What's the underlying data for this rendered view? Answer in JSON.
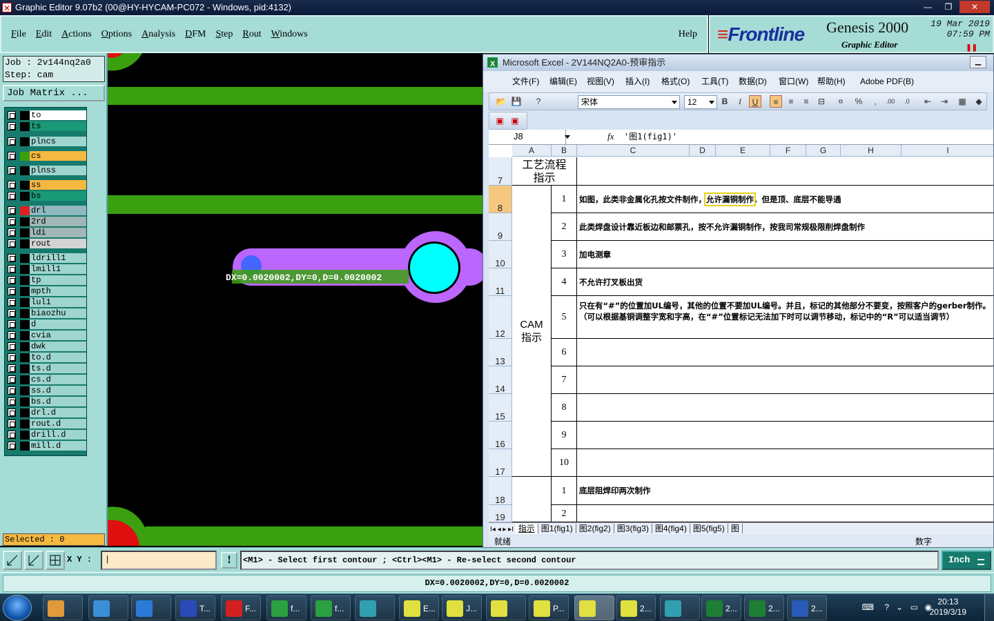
{
  "genesis": {
    "window_title": "Graphic Editor 9.07b2 (00@HY-HYCAM-PC072 - Windows, pid:4132)",
    "menu": [
      "File",
      "Edit",
      "Actions",
      "Options",
      "Analysis",
      "DFM",
      "Step",
      "Rout",
      "Windows"
    ],
    "help": "Help",
    "brand": {
      "logo": "Frontline",
      "product": "Genesis 2000",
      "subtitle": "Graphic Editor",
      "date": "19 Mar 2019",
      "time": "07:59 PM"
    },
    "job": "Job : 2v144nq2a0",
    "step": "Step: cam",
    "job_matrix": "Job Matrix ...",
    "layers": [
      {
        "name": "to",
        "color": "#ffffff",
        "swatch": "#000000"
      },
      {
        "name": "ts",
        "color": "#1a9977",
        "swatch": "#000000"
      },
      {
        "name": "plncs",
        "color": "#9ed5ce",
        "swatch": "#000000"
      },
      {
        "name": "cs",
        "color": "#f5b841",
        "swatch": "#3aa010"
      },
      {
        "name": "plnss",
        "color": "#9ed5ce",
        "swatch": "#000000"
      },
      {
        "name": "ss",
        "color": "#f5b841",
        "swatch": "#000000"
      },
      {
        "name": "bs",
        "color": "#1a9977",
        "swatch": "#000000"
      },
      {
        "name": "drl",
        "color": "#8fb8bf",
        "swatch": "#e02020"
      },
      {
        "name": "2rd",
        "color": "#9fb7b5",
        "swatch": "#000000"
      },
      {
        "name": "ldi",
        "color": "#9fb7b5",
        "swatch": "#000000"
      },
      {
        "name": "rout",
        "color": "#d3d3d3",
        "swatch": "#000000"
      },
      {
        "name": "ldrill1",
        "color": "#9ed5ce",
        "swatch": "#000000"
      },
      {
        "name": "lmill1",
        "color": "#9ed5ce",
        "swatch": "#000000"
      },
      {
        "name": "tp",
        "color": "#9ed5ce",
        "swatch": "#000000"
      },
      {
        "name": "mpth",
        "color": "#9ed5ce",
        "swatch": "#000000"
      },
      {
        "name": "lul1",
        "color": "#9ed5ce",
        "swatch": "#000000"
      },
      {
        "name": "biaozhu",
        "color": "#9ed5ce",
        "swatch": "#000000"
      },
      {
        "name": "d",
        "color": "#9ed5ce",
        "swatch": "#000000"
      },
      {
        "name": "cvia",
        "color": "#9ed5ce",
        "swatch": "#000000"
      },
      {
        "name": "dwk",
        "color": "#9ed5ce",
        "swatch": "#000000"
      },
      {
        "name": "to.d",
        "color": "#9ed5ce",
        "swatch": "#000000"
      },
      {
        "name": "ts.d",
        "color": "#9ed5ce",
        "swatch": "#000000"
      },
      {
        "name": "cs.d",
        "color": "#9ed5ce",
        "swatch": "#000000"
      },
      {
        "name": "ss.d",
        "color": "#9ed5ce",
        "swatch": "#000000"
      },
      {
        "name": "bs.d",
        "color": "#9ed5ce",
        "swatch": "#000000"
      },
      {
        "name": "drl.d",
        "color": "#9ed5ce",
        "swatch": "#000000"
      },
      {
        "name": "rout.d",
        "color": "#9ed5ce",
        "swatch": "#000000"
      },
      {
        "name": "drill.d",
        "color": "#9ed5ce",
        "swatch": "#000000"
      },
      {
        "name": "mill.d",
        "color": "#9ed5ce",
        "swatch": "#000000"
      }
    ],
    "selected": "Selected : 0",
    "measure_label": "DX=0.0020002,DY=0,D=0.0020002",
    "xy_label": "X Y :",
    "prompt": "<M1> - Select first contour ; <Ctrl><M1> - Re-select second contour",
    "units": "Inch",
    "status": "DX=0.0020002,DY=0,D=0.0020002",
    "colors": {
      "panel": "#a5dcd6",
      "trace": "#3aa010",
      "pad": "#00ffff",
      "mask": "#bb66ff"
    }
  },
  "excel": {
    "title": "Microsoft Excel - 2V144NQ2A0-预审指示",
    "menu": [
      "文件(F)",
      "编辑(E)",
      "视图(V)",
      "插入(I)",
      "格式(O)",
      "工具(T)",
      "数据(D)",
      "窗口(W)",
      "帮助(H)",
      "Adobe PDF(B)"
    ],
    "font": "宋体",
    "size": "12",
    "namebox": "J8",
    "fx": "fx",
    "formula": "'图1(fig1)'",
    "columns": [
      "A",
      "B",
      "C",
      "D",
      "E",
      "F",
      "G",
      "H",
      "I"
    ],
    "rows": [
      "7",
      "8",
      "9",
      "10",
      "11",
      "12",
      "13",
      "14",
      "15",
      "16",
      "17",
      "18",
      "19"
    ],
    "header_cell": "工艺流程指示",
    "group_label": "CAM指示",
    "items": [
      {
        "n": "1",
        "text_pre": "如图，此类非金属化孔按文件制作，",
        "text_hl": "允许漏铜制作",
        "text_post": "，但是顶、底层不能导通"
      },
      {
        "n": "2",
        "text": "此类焊盘设计靠近板边和邮票孔，按不允许漏铜制作，按我司常规极限削焊盘制作"
      },
      {
        "n": "3",
        "text": "加电测章"
      },
      {
        "n": "4",
        "text": "不允许打叉板出货"
      },
      {
        "n": "5",
        "text": "只在有“#”的位置加UL编号，其他的位置不要加UL编号。并且，标记的其他部分不要变，按照客户的gerber制作。（可以根据基铜调整字宽和字高，在“#”位置标记无法加下时可以调节移动，标记中的“R”可以适当调节）"
      },
      {
        "n": "6",
        "text": ""
      },
      {
        "n": "7",
        "text": ""
      },
      {
        "n": "8",
        "text": ""
      },
      {
        "n": "9",
        "text": ""
      },
      {
        "n": "10",
        "text": ""
      }
    ],
    "items2": [
      {
        "n": "1",
        "text": "底层阻焊印两次制作"
      },
      {
        "n": "2",
        "text": ""
      }
    ],
    "sheets": [
      "指示",
      "图1(fig1)",
      "图2(fig2)",
      "图3(fig3)",
      "图4(fig4)",
      "图5(fig5)",
      "图"
    ],
    "status_left": "就绪",
    "status_right": "数字"
  },
  "taskbar": {
    "buttons": [
      {
        "label": "",
        "icon": "shell-icon",
        "color": "#e09a3a"
      },
      {
        "label": "",
        "icon": "arrow-app-icon",
        "color": "#3a8fd8"
      },
      {
        "label": "",
        "icon": "ie-icon",
        "color": "#2a7ad8"
      },
      {
        "label": "T...",
        "icon": "floppy-icon",
        "color": "#2a4ab8"
      },
      {
        "label": "F...",
        "icon": "foxit-icon",
        "color": "#d02020"
      },
      {
        "label": "f...",
        "icon": "p-green-icon",
        "color": "#2aa040"
      },
      {
        "label": "f...",
        "icon": "p-green-icon",
        "color": "#2aa040"
      },
      {
        "label": "",
        "icon": "eye-app-icon",
        "color": "#30a0b0"
      },
      {
        "label": "E...",
        "icon": "genesis-icon",
        "color": "#e0e040"
      },
      {
        "label": "J...",
        "icon": "genesis-icon",
        "color": "#e0e040"
      },
      {
        "label": "",
        "icon": "genesis-icon",
        "color": "#e0e040"
      },
      {
        "label": "P...",
        "icon": "genesis-icon",
        "color": "#e0e040"
      },
      {
        "label": "",
        "icon": "genesis-icon",
        "color": "#e0e040"
      },
      {
        "label": "2...",
        "icon": "genesis-icon",
        "color": "#e0e040"
      },
      {
        "label": "",
        "icon": "eye-app-icon",
        "color": "#30a0b0"
      },
      {
        "label": "2...",
        "icon": "excel-icon",
        "color": "#1e7e34"
      },
      {
        "label": "2...",
        "icon": "excel-icon",
        "color": "#1e7e34"
      },
      {
        "label": "2...",
        "icon": "word-icon",
        "color": "#2a5ab8"
      }
    ],
    "time": "20:13",
    "date": "2019/3/19"
  }
}
